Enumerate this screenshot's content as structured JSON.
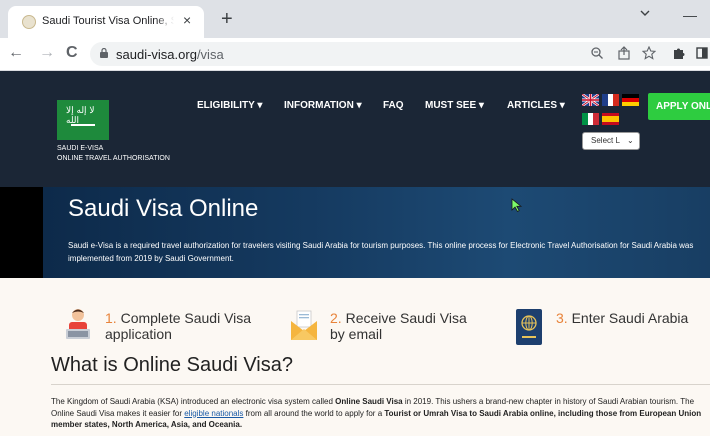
{
  "browser": {
    "tab_title": "Saudi Tourist Visa Online, Saudi Visa",
    "tab_close": "×",
    "new_tab": "+",
    "url_host": "saudi-visa.org",
    "url_path": "/visa",
    "back": "←",
    "forward": "→",
    "reload": "C"
  },
  "header": {
    "logo_script": "لا إله إلا الله",
    "brand_line1": "SAUDI E-VISA",
    "brand_line2": "ONLINE TRAVEL AUTHORISATION",
    "menu": [
      {
        "label": "ELIGIBILITY ▾"
      },
      {
        "label": "INFORMATION ▾"
      },
      {
        "label": "FAQ"
      },
      {
        "label": "MUST SEE ▾"
      },
      {
        "label": "ARTICLES ▾"
      }
    ],
    "apply_label": "APPLY ONLINE",
    "language_select": "Select L",
    "flags": [
      "united-kingdom",
      "france",
      "germany",
      "italy",
      "spain"
    ]
  },
  "hero": {
    "title": "Saudi Visa Online",
    "text": "Saudi e-Visa is a required travel authorization for travelers visiting Saudi Arabia for tourism purposes. This online process for Electronic Travel Authorisation for Saudi Arabia was implemented from 2019 by Saudi Government."
  },
  "steps": [
    {
      "num": "1.",
      "line1": "Complete Saudi Visa",
      "line2": "application",
      "icon": "person-laptop-icon"
    },
    {
      "num": "2.",
      "line1": "Receive Saudi Visa",
      "line2": "by email",
      "icon": "envelope-icon"
    },
    {
      "num": "3.",
      "line1": "Enter Saudi Arabia",
      "line2": "",
      "icon": "passport-icon"
    }
  ],
  "section": {
    "title": "What is Online Saudi Visa?",
    "p1_a": "The Kingdom of Saudi Arabia (KSA) introduced an electronic visa system called ",
    "p1_b": "Online Saudi Visa",
    "p1_c": " in 2019. This ushers a brand-new chapter in history of Saudi Arabian tourism. The Online Saudi Visa makes it easier for ",
    "p1_link": "eligible nationals",
    "p1_d": " from all around the world to apply for a ",
    "p1_e": "Tourist or Umrah Visa to Saudi Arabia online, including those from European Union member states, North America, Asia, and Oceania."
  },
  "colors": {
    "header_bg": "#1b2636",
    "apply_green": "#2ecc40",
    "step_number_orange": "#e8833a",
    "page_bg": "#fcf8f3"
  }
}
